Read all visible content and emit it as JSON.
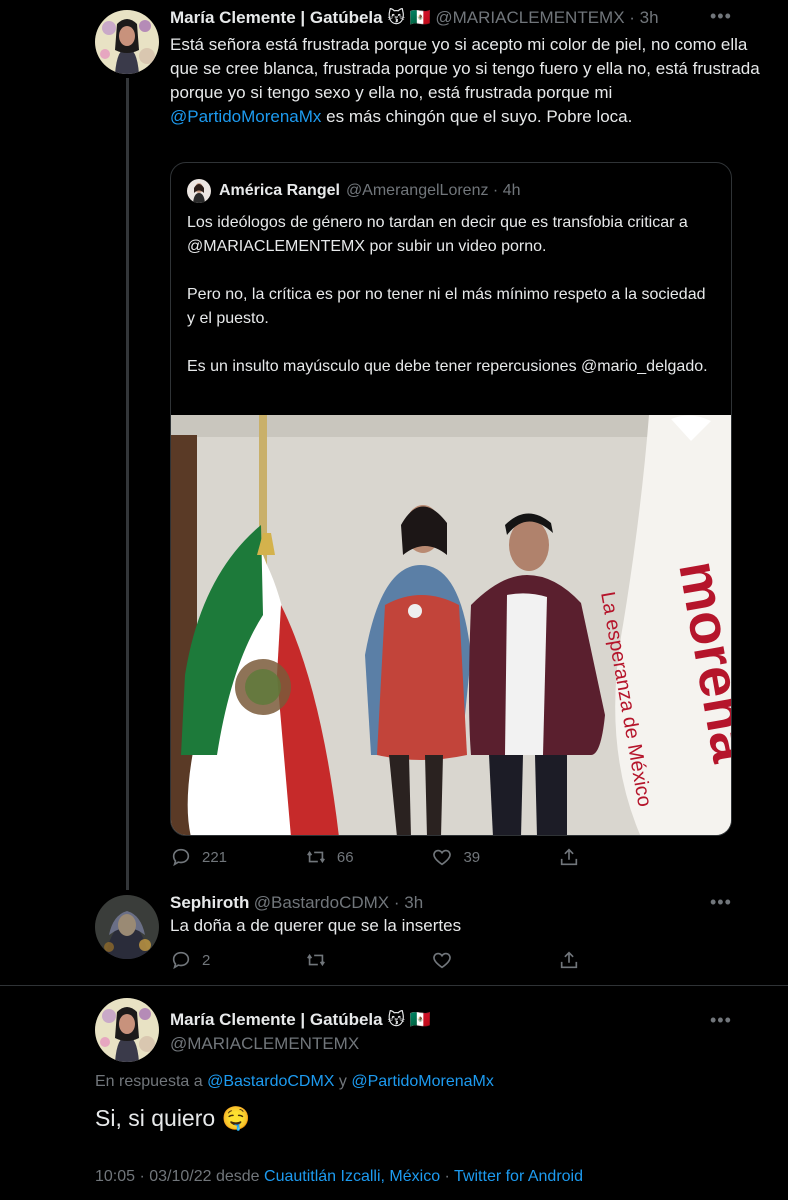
{
  "tweet1": {
    "name": "María Clemente | Gatúbela 😽 🇲🇽",
    "handle": "@MARIACLEMENTEMX · 3h",
    "text_a": "Está señora está frustrada porque yo si acepto mi color de piel, no como ella que se cree blanca, frustrada porque yo si tengo fuero y ella no, está frustrada porque yo si tengo sexo y ella no, está frustrada porque mi ",
    "mention": "@PartidoMorenaMx",
    "text_b": " es más chingón que el suyo. Pobre loca.",
    "quote": {
      "name": "América Rangel",
      "handle": "@AmerangelLorenz · 4h",
      "p1": "Los ideólogos de género no tardan en decir que es transfobia criticar a @MARIACLEMENTEMX por subir un video porno.",
      "p2": "Pero no, la crítica es por no tener ni el más mínimo respeto a la sociedad y el puesto.",
      "p3": "Es un insulto mayúsculo que debe tener repercusiones @mario_delgado.",
      "image_banner_title": "morena",
      "image_banner_subtitle": "La esperanza de México"
    },
    "replies": "221",
    "retweets": "66",
    "likes": "39"
  },
  "tweet2": {
    "name": "Sephiroth",
    "handle": "@BastardoCDMX · 3h",
    "text": "La doña a de querer que se la insertes",
    "replies": "2"
  },
  "tweet3": {
    "name": "María Clemente | Gatúbela 😽 🇲🇽",
    "handle": "@MARIACLEMENTEMX",
    "reply_prefix": "En respuesta a ",
    "reply_to_1": "@BastardoCDMX",
    "reply_and": " y ",
    "reply_to_2": "@PartidoMorenaMx",
    "text": "Si, si quiero 🤤",
    "meta_time": "10:05 · 03/10/22 desde ",
    "meta_location": "Cuautitlán Izcalli, México",
    "meta_sep": " · ",
    "meta_client": "Twitter for Android"
  },
  "colors": {
    "background": "#000000",
    "text": "#e7e9ea",
    "secondary": "#71767b",
    "link": "#1d9bf0",
    "morena": "#b5152b"
  },
  "more_label": "•••"
}
